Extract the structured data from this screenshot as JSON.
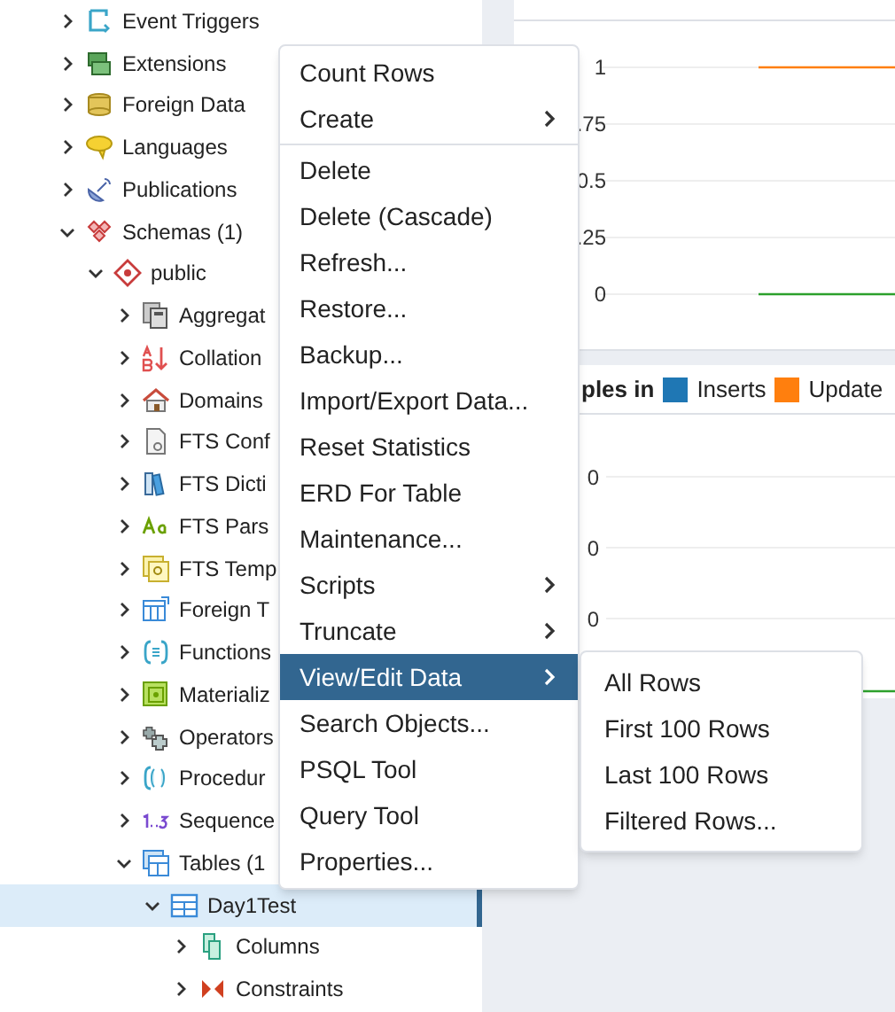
{
  "tree": [
    {
      "label": "Event Triggers",
      "kind": "event-trigger",
      "expanded": false
    },
    {
      "label": "Extensions",
      "kind": "extension",
      "expanded": false
    },
    {
      "label": "Foreign Data",
      "kind": "foreign-data",
      "expanded": false
    },
    {
      "label": "Languages",
      "kind": "language",
      "expanded": false
    },
    {
      "label": "Publications",
      "kind": "publication",
      "expanded": false
    },
    {
      "label": "Schemas (1)",
      "kind": "schemas",
      "expanded": true,
      "children": [
        {
          "label": "public",
          "kind": "schema",
          "expanded": true,
          "children": [
            {
              "label": "Aggregat",
              "kind": "aggregate",
              "expanded": false
            },
            {
              "label": "Collation",
              "kind": "collation",
              "expanded": false
            },
            {
              "label": "Domains",
              "kind": "domain",
              "expanded": false
            },
            {
              "label": "FTS Conf",
              "kind": "fts-config",
              "expanded": false
            },
            {
              "label": "FTS Dicti",
              "kind": "fts-dict",
              "expanded": false
            },
            {
              "label": "FTS Pars",
              "kind": "fts-parser",
              "expanded": false
            },
            {
              "label": "FTS Temp",
              "kind": "fts-template",
              "expanded": false
            },
            {
              "label": "Foreign T",
              "kind": "foreign-table",
              "expanded": false
            },
            {
              "label": "Functions",
              "kind": "function",
              "expanded": false
            },
            {
              "label": "Materializ",
              "kind": "matview",
              "expanded": false
            },
            {
              "label": "Operators",
              "kind": "operator",
              "expanded": false
            },
            {
              "label": "Procedur",
              "kind": "procedure",
              "expanded": false
            },
            {
              "label": "Sequence",
              "kind": "sequence",
              "expanded": false
            },
            {
              "label": "Tables (1",
              "kind": "tables",
              "expanded": true,
              "children": [
                {
                  "label": "Day1Test",
                  "kind": "table",
                  "expanded": true,
                  "selected": true,
                  "children": [
                    {
                      "label": "Columns",
                      "kind": "columns",
                      "expanded": false
                    },
                    {
                      "label": "Constraints",
                      "kind": "constraints",
                      "expanded": false
                    }
                  ]
                }
              ]
            }
          ]
        }
      ]
    }
  ],
  "chart_panel": {
    "tick_labels": [
      "1",
      ".75",
      "0.5",
      ".25",
      "0"
    ]
  },
  "tuples_panel": {
    "title": "ples in",
    "legend": [
      {
        "label": "Inserts",
        "color": "#1f77b4"
      },
      {
        "label": "Update",
        "color": "#ff7f0e"
      }
    ],
    "tick_labels": [
      "0",
      "0",
      "0"
    ]
  },
  "context_menu": {
    "items": [
      {
        "label": "Count Rows",
        "submenu": false,
        "selected": false
      },
      {
        "label": "Create",
        "submenu": true,
        "selected": false,
        "divider_after": true
      },
      {
        "label": "Delete",
        "submenu": false,
        "selected": false
      },
      {
        "label": "Delete (Cascade)",
        "submenu": false,
        "selected": false
      },
      {
        "label": "Refresh...",
        "submenu": false,
        "selected": false
      },
      {
        "label": "Restore...",
        "submenu": false,
        "selected": false
      },
      {
        "label": "Backup...",
        "submenu": false,
        "selected": false
      },
      {
        "label": "Import/Export Data...",
        "submenu": false,
        "selected": false
      },
      {
        "label": "Reset Statistics",
        "submenu": false,
        "selected": false
      },
      {
        "label": "ERD For Table",
        "submenu": false,
        "selected": false
      },
      {
        "label": "Maintenance...",
        "submenu": false,
        "selected": false
      },
      {
        "label": "Scripts",
        "submenu": true,
        "selected": false
      },
      {
        "label": "Truncate",
        "submenu": true,
        "selected": false
      },
      {
        "label": "View/Edit Data",
        "submenu": true,
        "selected": true
      },
      {
        "label": "Search Objects...",
        "submenu": false,
        "selected": false
      },
      {
        "label": "PSQL Tool",
        "submenu": false,
        "selected": false
      },
      {
        "label": "Query Tool",
        "submenu": false,
        "selected": false
      },
      {
        "label": "Properties...",
        "submenu": false,
        "selected": false
      }
    ]
  },
  "submenu": {
    "items": [
      {
        "label": "All Rows"
      },
      {
        "label": "First 100 Rows"
      },
      {
        "label": "Last 100 Rows"
      },
      {
        "label": "Filtered Rows..."
      }
    ]
  }
}
